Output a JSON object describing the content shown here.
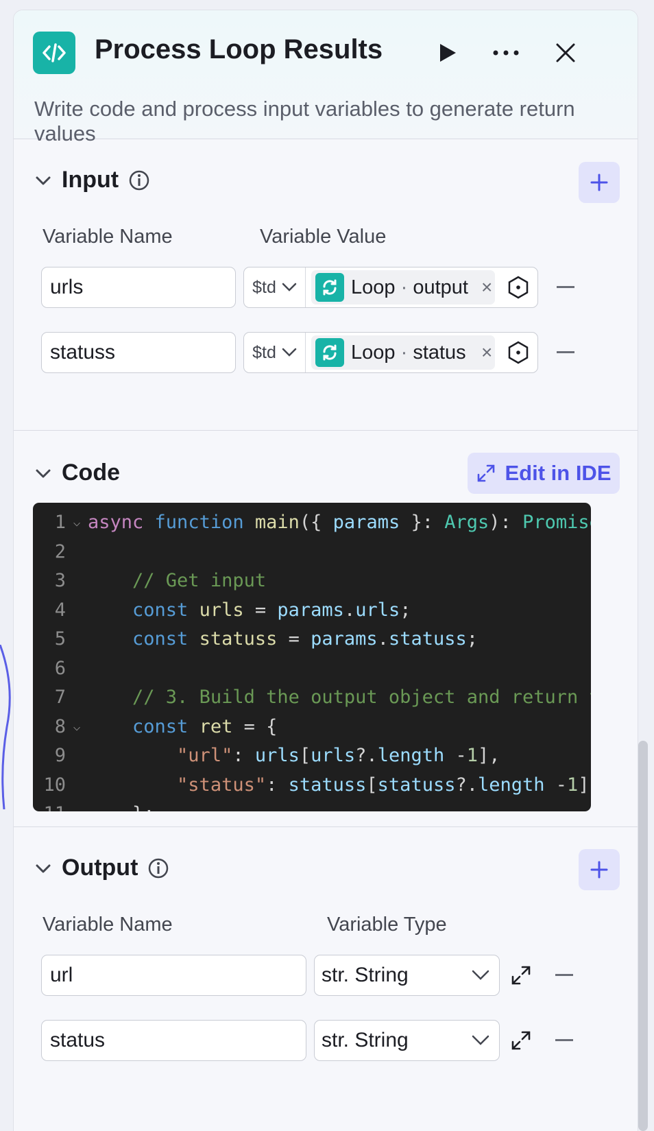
{
  "header": {
    "title": "Process Loop Results",
    "subtitle": "Write code and process input variables to generate return values"
  },
  "input": {
    "title": "Input",
    "col_name": "Variable Name",
    "col_value": "Variable Value",
    "rows": [
      {
        "name": "urls",
        "type": "$td",
        "ref_node": "Loop",
        "ref_sep": "·",
        "ref_field": "output"
      },
      {
        "name": "statuss",
        "type": "$td",
        "ref_node": "Loop",
        "ref_sep": "·",
        "ref_field": "status"
      }
    ]
  },
  "code": {
    "title": "Code",
    "ide_label": "Edit in IDE",
    "lines": [
      {
        "n": "1"
      },
      {
        "n": "2"
      },
      {
        "n": "3"
      },
      {
        "n": "4"
      },
      {
        "n": "5"
      },
      {
        "n": "6"
      },
      {
        "n": "7"
      },
      {
        "n": "8"
      },
      {
        "n": "9"
      },
      {
        "n": "10"
      }
    ]
  },
  "output": {
    "title": "Output",
    "col_name": "Variable Name",
    "col_type": "Variable Type",
    "rows": [
      {
        "name": "url",
        "type": "str. String"
      },
      {
        "name": "status",
        "type": "str. String"
      }
    ]
  },
  "colors": {
    "accent": "#4d53e8",
    "node": "#18b3a7",
    "editor_bg": "#1f1f1f"
  }
}
